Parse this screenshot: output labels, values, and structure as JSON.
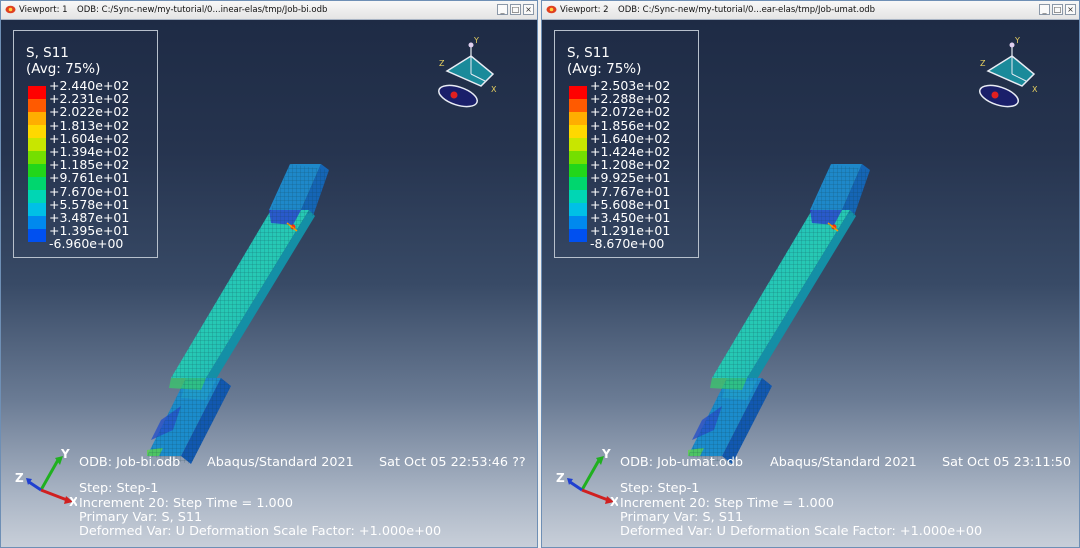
{
  "viewports": [
    {
      "title": "Viewport: 1",
      "odb_path": "ODB: C:/Sync-new/my-tutorial/0...inear-elas/tmp/Job-bi.odb",
      "legend": {
        "title": "S, S11",
        "subtitle": "(Avg: 75%)",
        "values": [
          "+2.440e+02",
          "+2.231e+02",
          "+2.022e+02",
          "+1.813e+02",
          "+1.604e+02",
          "+1.394e+02",
          "+1.185e+02",
          "+9.761e+01",
          "+7.670e+01",
          "+5.578e+01",
          "+3.487e+01",
          "+1.395e+01",
          "-6.960e+00"
        ]
      },
      "info": {
        "odb": "ODB: Job-bi.odb",
        "solver": "Abaqus/Standard 2021",
        "date": "Sat Oct 05 22:53:46 ??",
        "step": "Step: Step-1",
        "increment": "Increment     20: Step Time =     1.000",
        "primary": "Primary Var: S, S11",
        "deformed": "Deformed Var: U   Deformation Scale Factor: +1.000e+00"
      }
    },
    {
      "title": "Viewport: 2",
      "odb_path": "ODB: C:/Sync-new/my-tutorial/0...ear-elas/tmp/Job-umat.odb",
      "legend": {
        "title": "S, S11",
        "subtitle": "(Avg: 75%)",
        "values": [
          "+2.503e+02",
          "+2.288e+02",
          "+2.072e+02",
          "+1.856e+02",
          "+1.640e+02",
          "+1.424e+02",
          "+1.208e+02",
          "+9.925e+01",
          "+7.767e+01",
          "+5.608e+01",
          "+3.450e+01",
          "+1.291e+01",
          "-8.670e+00"
        ]
      },
      "info": {
        "odb": "ODB: Job-umat.odb",
        "solver": "Abaqus/Standard 2021",
        "date": "Sat Oct 05 23:11:50",
        "step": "Step: Step-1",
        "increment": "Increment     20: Step Time =     1.000",
        "primary": "Primary Var: S, S11",
        "deformed": "Deformed Var: U   Deformation Scale Factor: +1.000e+00"
      }
    }
  ],
  "legend_colors": [
    "#ff0000",
    "#ff5a00",
    "#ffae00",
    "#ffd800",
    "#c8e600",
    "#74df00",
    "#22d61a",
    "#00d66e",
    "#00d6b4",
    "#00c0e6",
    "#0089ee",
    "#0050f0",
    "#0a18e8"
  ],
  "triad_labels": {
    "y": "Y",
    "z": "Z",
    "x": "X"
  },
  "window_buttons": {
    "minimize": "_",
    "restore": "□",
    "close": "×"
  }
}
